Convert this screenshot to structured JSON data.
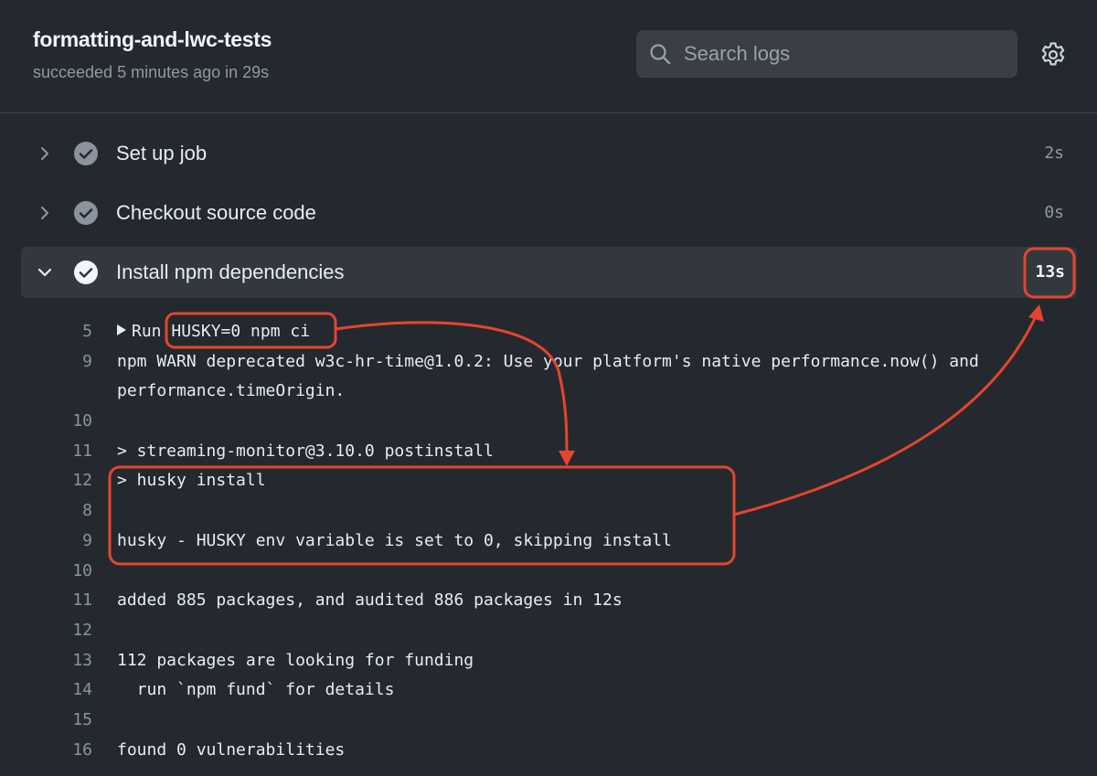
{
  "header": {
    "title": "formatting-and-lwc-tests",
    "subtitle": "succeeded 5 minutes ago in 29s",
    "search_placeholder": "Search logs"
  },
  "steps": [
    {
      "name": "Set up job",
      "duration": "2s",
      "expanded": false
    },
    {
      "name": "Checkout source code",
      "duration": "0s",
      "expanded": false
    },
    {
      "name": "Install npm dependencies",
      "duration": "13s",
      "expanded": true
    }
  ],
  "log": [
    {
      "num": "5",
      "run_label": "Run",
      "text": "HUSKY=0 npm ci"
    },
    {
      "num": "9",
      "text": "npm WARN deprecated w3c-hr-time@1.0.2: Use your platform's native performance.now() and"
    },
    {
      "num": "",
      "text": "performance.timeOrigin."
    },
    {
      "num": "10",
      "text": ""
    },
    {
      "num": "11",
      "text": "> streaming-monitor@3.10.0 postinstall"
    },
    {
      "num": "12",
      "text": "> husky install"
    },
    {
      "num": "8",
      "text": ""
    },
    {
      "num": "9",
      "text": "husky - HUSKY env variable is set to 0, skipping install"
    },
    {
      "num": "10",
      "text": ""
    },
    {
      "num": "11",
      "text": "added 885 packages, and audited 886 packages in 12s"
    },
    {
      "num": "12",
      "text": ""
    },
    {
      "num": "13",
      "text": "112 packages are looking for funding"
    },
    {
      "num": "14",
      "text": "  run `npm fund` for details"
    },
    {
      "num": "15",
      "text": ""
    },
    {
      "num": "16",
      "text": "found 0 vulnerabilities"
    }
  ],
  "colors": {
    "background": "#24292f",
    "annotation": "#e5452f"
  }
}
